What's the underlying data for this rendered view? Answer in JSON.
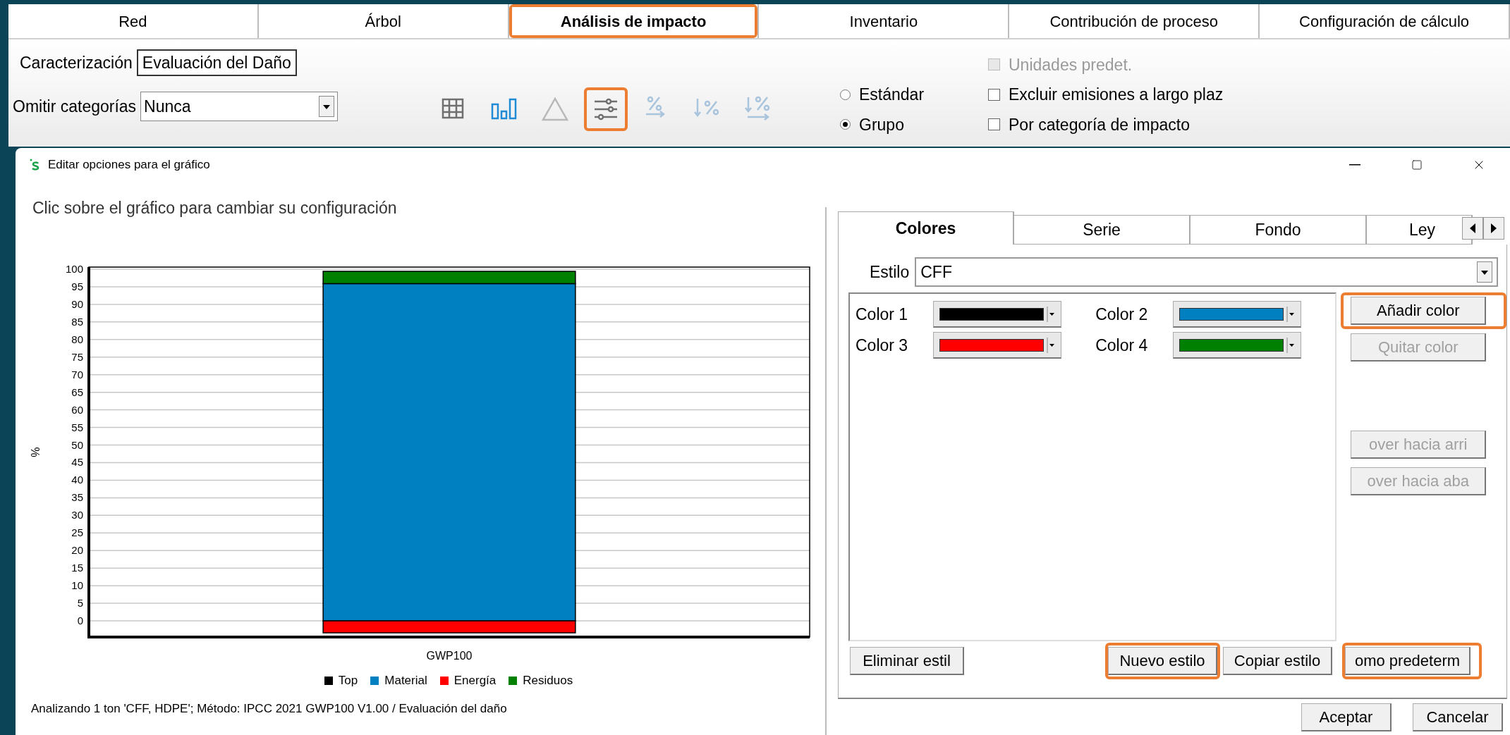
{
  "top_tabs": [
    {
      "label": "Red",
      "selected": false,
      "highlighted": false
    },
    {
      "label": "Árbol",
      "selected": false,
      "highlighted": false
    },
    {
      "label": "Análisis de impacto",
      "selected": true,
      "highlighted": true
    },
    {
      "label": "Inventario",
      "selected": false,
      "highlighted": false
    },
    {
      "label": "Contribución de proceso",
      "selected": false,
      "highlighted": false
    },
    {
      "label": "Configuración de cálculo",
      "selected": false,
      "highlighted": false
    }
  ],
  "toolbar": {
    "characterization": {
      "label": "Caracterización",
      "value": "Evaluación del Daño"
    },
    "omit": {
      "label": "Omitir categorías",
      "value": "Nunca"
    },
    "icon_buttons": [
      {
        "kind": "grid",
        "disabled": false,
        "highlighted": false
      },
      {
        "kind": "bars",
        "disabled": false,
        "highlighted": false
      },
      {
        "kind": "triangle",
        "disabled": false,
        "highlighted": false
      },
      {
        "kind": "sliders",
        "disabled": false,
        "highlighted": true
      },
      {
        "kind": "percent",
        "disabled": true,
        "highlighted": false
      },
      {
        "kind": "sort_percent",
        "disabled": true,
        "highlighted": false
      },
      {
        "kind": "sort_percent_arrow",
        "disabled": true,
        "highlighted": false
      }
    ],
    "view_mode": [
      {
        "label": "Estándar",
        "selected": false
      },
      {
        "label": "Grupo",
        "selected": true
      }
    ],
    "options": [
      {
        "label": "Unidades predet.",
        "checked": false,
        "disabled": true
      },
      {
        "label": "Excluir emisiones a largo plaz",
        "checked": false,
        "disabled": false
      },
      {
        "label": "Por categoría de impacto",
        "checked": false,
        "disabled": false
      }
    ]
  },
  "dialog": {
    "title": "Editar opciones para el gráfico",
    "hint": "Clic sobre el gráfico para cambiar su configuración",
    "chart_data": {
      "type": "bar",
      "stacked": true,
      "grid": true,
      "ylabel": "%",
      "categories": [
        "GWP100"
      ],
      "ylim": [
        -4.6,
        100.6
      ],
      "yticks": [
        0,
        5,
        10,
        15,
        20,
        25,
        30,
        35,
        40,
        45,
        50,
        55,
        60,
        65,
        70,
        75,
        80,
        85,
        90,
        95,
        100
      ],
      "series": [
        {
          "name": "Top",
          "color": "#000000",
          "values": [
            null
          ]
        },
        {
          "name": "Material",
          "color": "#0080c0",
          "values": [
            95.9
          ]
        },
        {
          "name": "Energía",
          "color": "#ff0000",
          "values": [
            -3.4
          ]
        },
        {
          "name": "Residuos",
          "color": "#008000",
          "values": [
            3.5
          ]
        }
      ]
    },
    "footer": "Analizando 1 ton 'CFF, HDPE'; Método: IPCC 2021 GWP100 V1.00 / Evaluación del daño",
    "tabs": [
      {
        "label": "Colores",
        "selected": true
      },
      {
        "label": "Serie",
        "selected": false
      },
      {
        "label": "Fondo",
        "selected": false
      },
      {
        "label": "Ley",
        "selected": false
      }
    ],
    "style": {
      "label": "Estilo",
      "value": "CFF"
    },
    "colors": [
      {
        "label": "Color 1",
        "color": "#000000"
      },
      {
        "label": "Color 2",
        "color": "#0080c0"
      },
      {
        "label": "Color 3",
        "color": "#ff0000"
      },
      {
        "label": "Color 4",
        "color": "#008000"
      }
    ],
    "side_buttons": [
      {
        "label": "Añadir color",
        "disabled": false,
        "highlighted": true
      },
      {
        "label": "Quitar color",
        "disabled": true,
        "highlighted": false
      },
      {
        "label": "over hacia arri",
        "disabled": true,
        "highlighted": false
      },
      {
        "label": "over hacia aba",
        "disabled": true,
        "highlighted": false
      }
    ],
    "bottom_buttons": [
      {
        "label": "Eliminar estil",
        "highlighted": false
      },
      {
        "label": "Nuevo estilo",
        "highlighted": true
      },
      {
        "label": "Copiar estilo",
        "highlighted": false
      },
      {
        "label": "omo predeterm",
        "highlighted": true
      }
    ],
    "actions": [
      {
        "label": "Aceptar"
      },
      {
        "label": "Cancelar"
      }
    ]
  }
}
